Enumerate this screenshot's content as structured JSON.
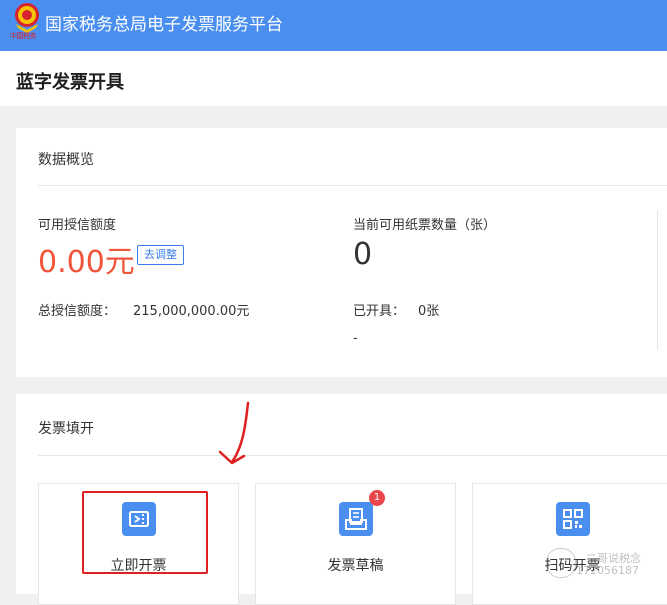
{
  "header": {
    "platform_title": "国家税务总局电子发票服务平台",
    "emblem_caption": "中国税务",
    "background_color": "#4a8ff0"
  },
  "page": {
    "title": "蓝字发票开具"
  },
  "overview": {
    "section_title": "数据概览",
    "credit_label": "可用授信额度",
    "credit_value": "0.00元",
    "adjust_button": "去调整",
    "total_credit_label": "总授信额度：",
    "total_credit_value": "215,000,000.00元",
    "paper_label": "当前可用纸票数量（张）",
    "paper_value": "0",
    "issued_label": "已开具：",
    "issued_value": "0张",
    "dash": "-",
    "accent_color": "#f0553a"
  },
  "invoice_fill": {
    "section_title": "发票填开",
    "tiles": [
      {
        "label": "立即开票",
        "icon": "issue-invoice-icon"
      },
      {
        "label": "发票草稿",
        "icon": "invoice-draft-icon",
        "badge": "1"
      },
      {
        "label": "扫码开票",
        "icon": "qr-code-icon"
      }
    ]
  },
  "watermark": {
    "line1": "二哥说税念",
    "line2": "172056187"
  }
}
